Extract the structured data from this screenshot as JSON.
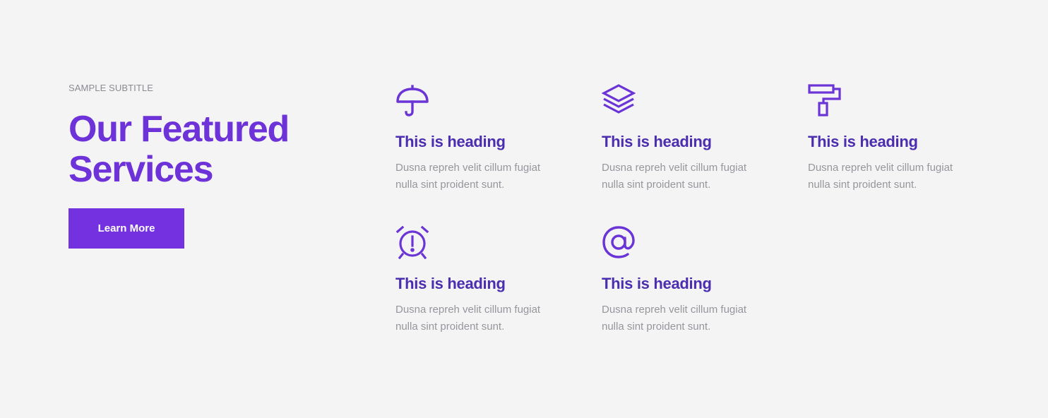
{
  "intro": {
    "subtitle": "SAMPLE SUBTITLE",
    "title_line1": "Our Featured",
    "title_line2": "Services",
    "button_label": "Learn More"
  },
  "colors": {
    "accent": "#7431e0",
    "heading": "#4b2db0",
    "text_muted": "#96969c",
    "background": "#f4f4f5"
  },
  "services": [
    {
      "icon": "umbrella-icon",
      "heading": "This is heading",
      "line1": "Dusna repreh velit cillum fugiat",
      "line2": "nulla sint proident sunt."
    },
    {
      "icon": "layers-icon",
      "heading": "This is heading",
      "line1": "Dusna repreh velit cillum fugiat",
      "line2": "nulla sint proident sunt."
    },
    {
      "icon": "paint-roller-icon",
      "heading": "This is heading",
      "line1": "Dusna repreh velit cillum fugiat",
      "line2": "nulla sint proident sunt."
    },
    {
      "icon": "alarm-clock-icon",
      "heading": "This is heading",
      "line1": "Dusna repreh velit cillum fugiat",
      "line2": "nulla sint proident sunt."
    },
    {
      "icon": "at-sign-icon",
      "heading": "This is heading",
      "line1": "Dusna repreh velit cillum fugiat",
      "line2": "nulla sint proident sunt."
    }
  ]
}
